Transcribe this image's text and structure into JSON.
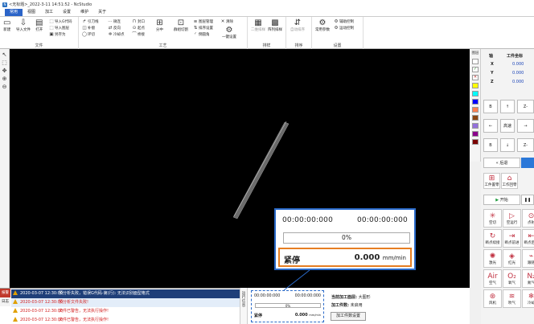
{
  "titlebar": {
    "text": "<无标题>_2022-3-11 14:51:52 - NcStudio"
  },
  "menu": [
    "常用",
    "视图",
    "加工",
    "设置",
    "维护",
    "关于"
  ],
  "ribbon": {
    "file": {
      "label": "文件",
      "new": "新建",
      "import": "导入文件",
      "open": "打开",
      "import_gcode": "导入G代码",
      "import_layer": "导入图层",
      "save_as": "另存为"
    },
    "craft": {
      "label": "工艺",
      "leadin": "引刀线",
      "micro": "微连",
      "ring": "环切",
      "compensate": "补偿",
      "clear": "清除",
      "cold_corner": "冷却点",
      "reverse": "反向",
      "seal": "封口",
      "start_point": "起点",
      "bridge": "桥接",
      "cut": "切割",
      "split": "分中",
      "sort": "排序",
      "group_cut": "群组切割",
      "manage": "图层管理",
      "order": "排序设置",
      "fillet": "倒圆角",
      "clear2": "清除",
      "one_key": "一键设置"
    },
    "nest": {
      "label": "排样",
      "quad": "二维排样",
      "array": "阵列排样"
    },
    "sort": {
      "label": "排序",
      "auto": "自动排序"
    },
    "settings": {
      "label": "设置",
      "params": "常用参数",
      "assist": "辅助控制",
      "motion": "运动控制"
    }
  },
  "colorbar": {
    "top_label": "图层",
    "swatches": [
      "#ffffff",
      "#ffffff",
      "#ffffff",
      "#ffff00",
      "#00ffff",
      "#0000ff",
      "#ff7f50",
      "#8b4513",
      "#9370db",
      "#8b008b",
      "#7a0000"
    ]
  },
  "axis_table": {
    "headers": [
      "轴",
      "工件坐标"
    ],
    "rows": [
      {
        "axis": "X",
        "value": "0.000"
      },
      {
        "axis": "Y",
        "value": "0.000"
      },
      {
        "axis": "Z",
        "value": "0.000"
      }
    ]
  },
  "jog": {
    "up": "↑",
    "down": "↓",
    "left": "←",
    "right": "→",
    "speed": "高速",
    "zplus": "Z+",
    "zminus": "Z-",
    "bplus": "B",
    "bminus": "B"
  },
  "right_buttons": {
    "back": "后退",
    "origin": "工件置零",
    "return": "工作回零",
    "start": "开始"
  },
  "func_buttons": [
    {
      "label": "空切",
      "icon": "✳"
    },
    {
      "label": "空运行",
      "icon": "▷"
    },
    {
      "label": "点射",
      "icon": "⊙"
    },
    {
      "label": "断点续接",
      "icon": "↻"
    },
    {
      "label": "断点前进",
      "icon": "⇥"
    },
    {
      "label": "断点后退",
      "icon": "⇤"
    },
    {
      "label": "激光",
      "icon": "✺"
    },
    {
      "label": "红光",
      "icon": "◈"
    },
    {
      "label": "跟随",
      "icon": "⌁"
    },
    {
      "label": "空气",
      "icon": "Air"
    },
    {
      "label": "氧气",
      "icon": "O₂"
    },
    {
      "label": "氮气",
      "icon": "N₂"
    },
    {
      "label": "风机",
      "icon": "⊛"
    },
    {
      "label": "吹气",
      "icon": "≋"
    },
    {
      "label": "冷却",
      "icon": "❄"
    }
  ],
  "log": {
    "tabs": [
      "报警",
      "日志"
    ],
    "rows": [
      {
        "time": "2020-03-07 12:30:00",
        "text": "预分析失败，错误G代码-第(行): 无法识别面型格式"
      },
      {
        "time": "2020-03-07 12:30:00",
        "text": "预分析文件失败!"
      },
      {
        "time": "2020-03-07 12:30:00",
        "text": "文件已警告，无法执行操作!"
      },
      {
        "time": "2020-03-07 12:30:00",
        "text": "文件已警告，无法执行操作!"
      }
    ]
  },
  "side_tab": "运行信息",
  "status": {
    "time_left": "00:00:00:000",
    "time_right": "00:00:00:000",
    "progress_label": "0%",
    "progress": 0,
    "state": "紧停",
    "speed": "0.000",
    "unit": "mm/min"
  },
  "process_info": {
    "layer_label": "当前加工面层:",
    "layer_value": "大图形",
    "count_label": "加工件数:",
    "count_value": "未启用",
    "settings_button": "加工件数设置"
  }
}
